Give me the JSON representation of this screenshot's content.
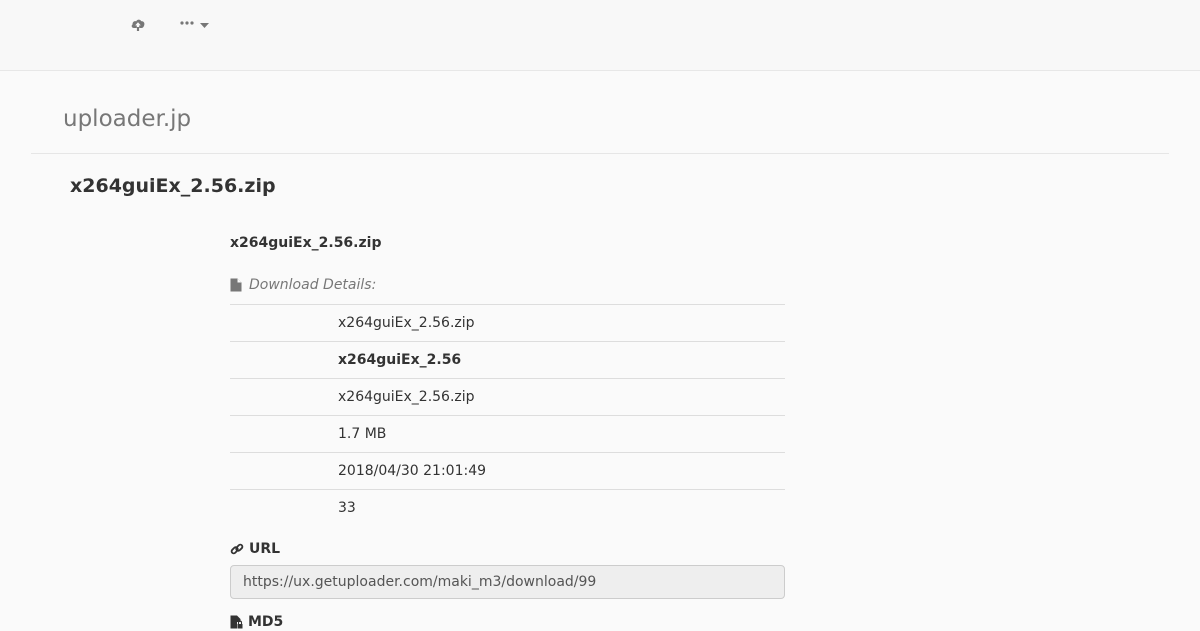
{
  "nav": {
    "upload_icon": "cloud-upload-icon",
    "more_icon": "ellipsis-icon",
    "caret_icon": "caret-down-icon"
  },
  "site": {
    "title": "uploader.jp"
  },
  "page": {
    "title": "x264guiEx_2.56.zip"
  },
  "file": {
    "heading": "x264guiEx_2.56.zip",
    "details_label": "Download Details:",
    "details_icon": "file-icon",
    "rows": [
      {
        "value": "x264guiEx_2.56.zip",
        "bold": false
      },
      {
        "value": "x264guiEx_2.56",
        "bold": true
      },
      {
        "value": "x264guiEx_2.56.zip",
        "bold": false
      },
      {
        "value": "1.7 MB",
        "bold": false
      },
      {
        "value": "2018/04/30 21:01:49",
        "bold": false
      },
      {
        "value": "33",
        "bold": false
      }
    ]
  },
  "url": {
    "label": "URL",
    "icon": "link-icon",
    "value": "https://ux.getuploader.com/maki_m3/download/99"
  },
  "md5": {
    "label": "MD5",
    "icon": "file-lock-icon"
  },
  "colors": {
    "background": "#fafafa",
    "navbar": "#f8f8f8",
    "muted_text": "#777777",
    "text": "#333333",
    "border": "#dddddd",
    "readonly_input": "#eeeeee"
  }
}
